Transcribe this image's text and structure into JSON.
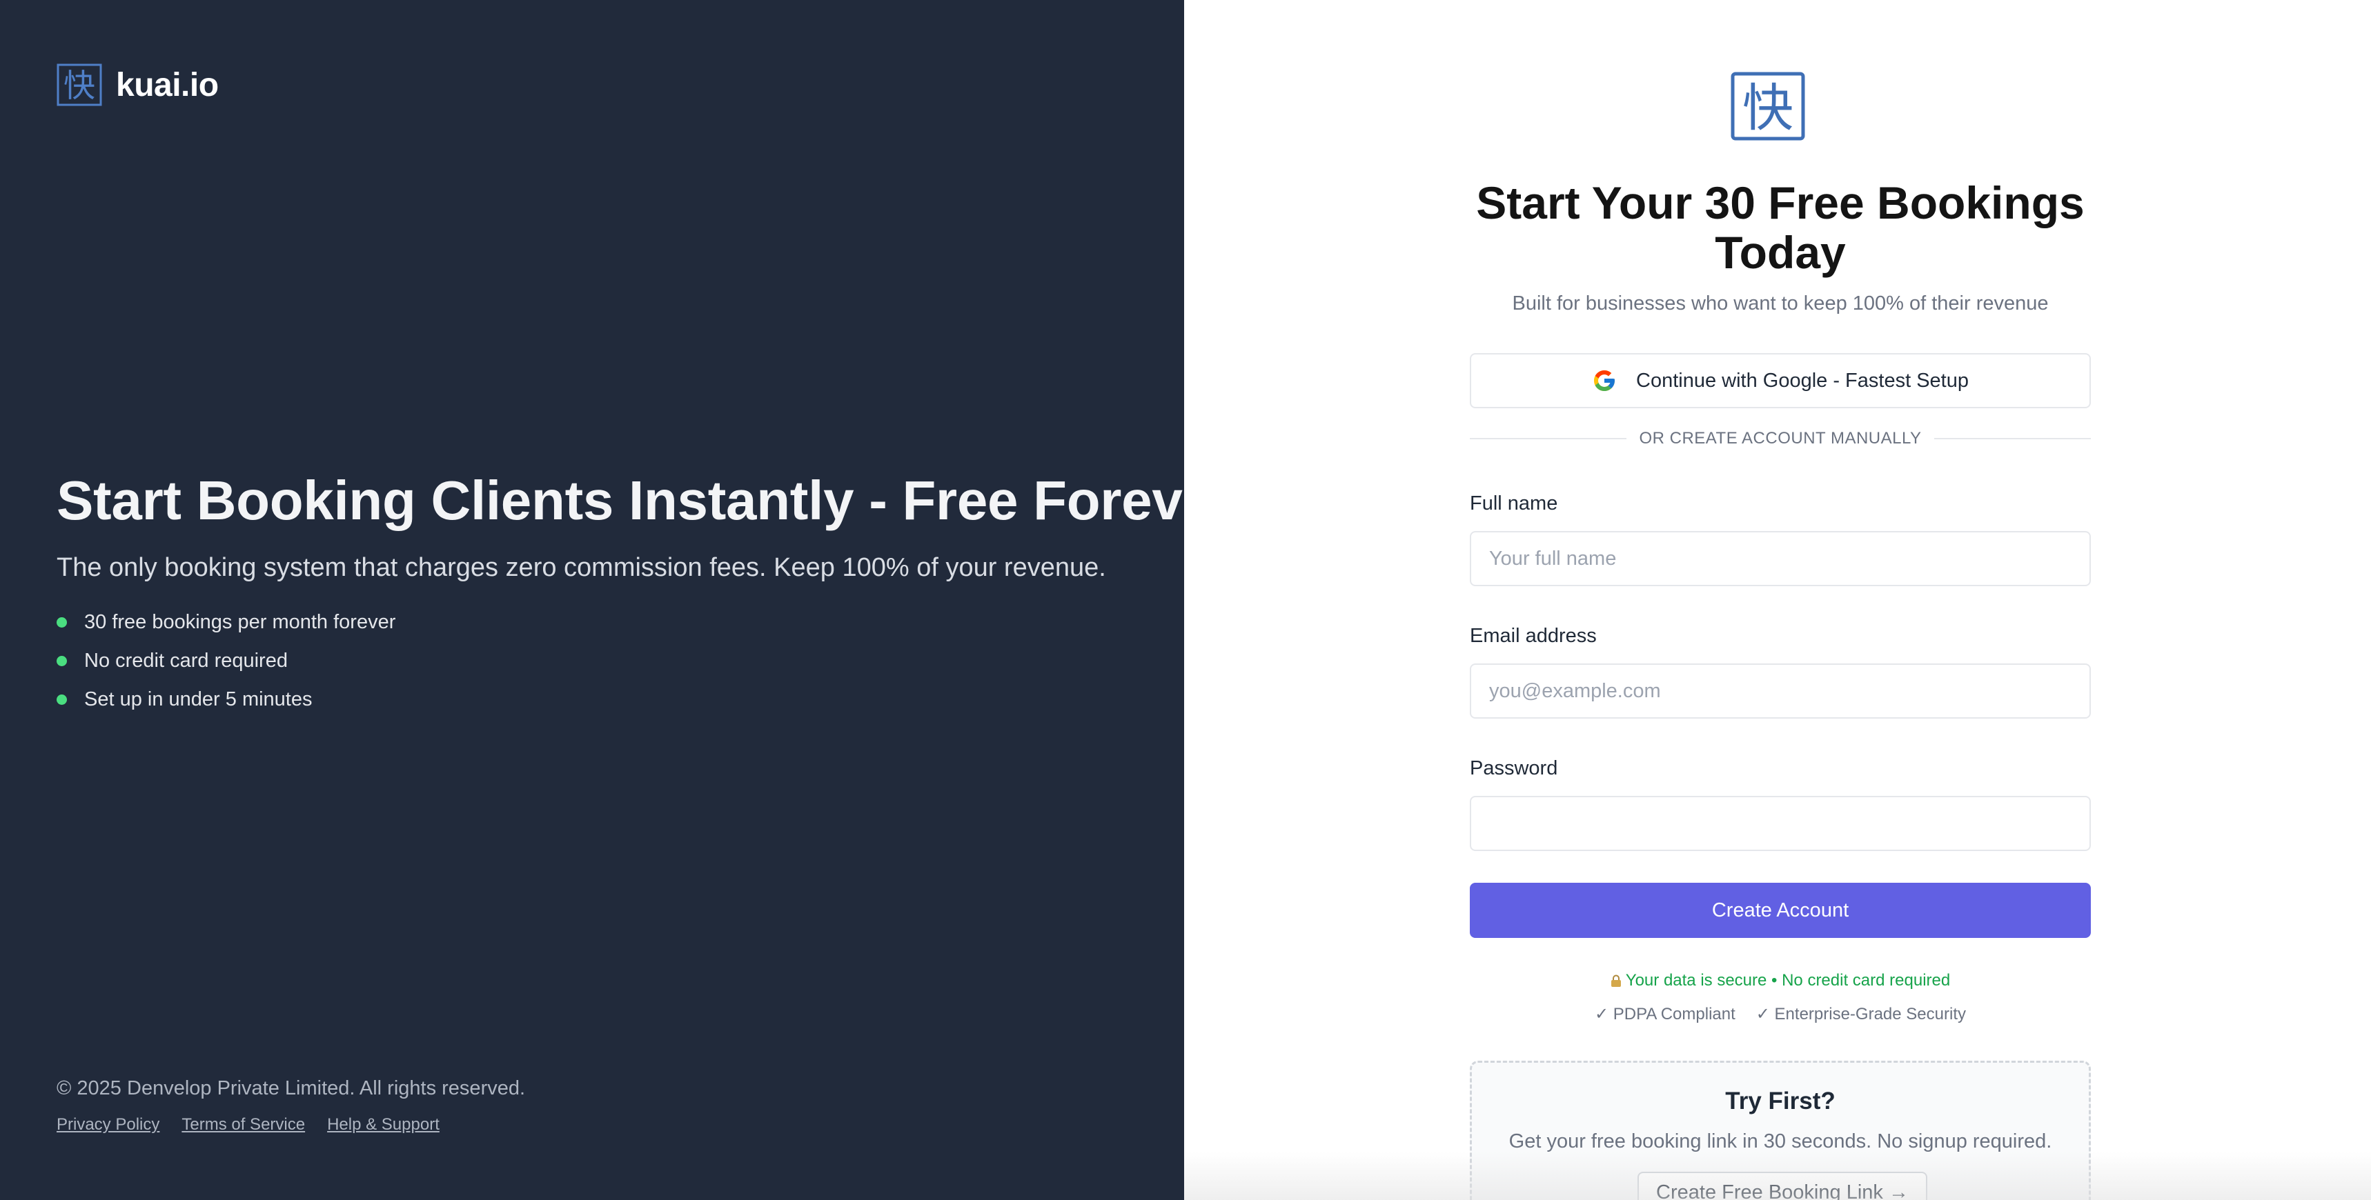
{
  "brand": {
    "name": "kuai.io",
    "mark_glyph": "快",
    "icon": "kuai-logo-icon"
  },
  "hero": {
    "title": "Start Booking Clients Instantly - Free Forever",
    "subtitle": "The only booking system that charges zero commission fees. Keep 100% of your revenue.",
    "benefits": [
      "30 free bookings per month forever",
      "No credit card required",
      "Set up in under 5 minutes"
    ]
  },
  "footer": {
    "copyright": "© 2025 Denvelop Private Limited. All rights reserved.",
    "links": [
      "Privacy Policy",
      "Terms of Service",
      "Help & Support"
    ]
  },
  "signup": {
    "title": "Start Your 30 Free Bookings Today",
    "subtitle": "Built for businesses who want to keep 100% of their revenue",
    "google_button": "Continue with Google - Fastest Setup",
    "divider": "OR CREATE ACCOUNT MANUALLY",
    "fields": {
      "full_name": {
        "label": "Full name",
        "placeholder": "Your full name"
      },
      "email": {
        "label": "Email address",
        "placeholder": "you@example.com"
      },
      "password": {
        "label": "Password",
        "placeholder": ""
      }
    },
    "submit": "Create Account",
    "secure_note": "Your data is secure • No credit card required",
    "badges": [
      "✓ PDPA Compliant",
      "✓ Enterprise-Grade Security"
    ]
  },
  "try_first": {
    "title": "Try First?",
    "description": "Get your free booking link in 30 seconds. No signup required.",
    "button": "Create Free Booking Link →"
  },
  "colors": {
    "left_bg": "#212a3b",
    "accent": "#6160e3",
    "success": "#16a34a",
    "bullet": "#4ade80",
    "logo_blue": "#3f6fb5"
  }
}
